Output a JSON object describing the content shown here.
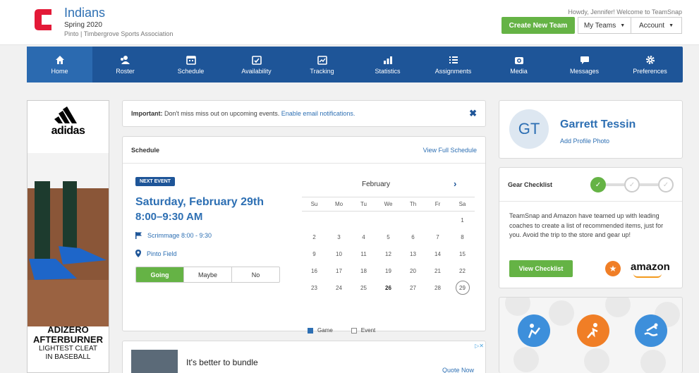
{
  "header": {
    "team_name": "Indians",
    "season": "Spring 2020",
    "division": "Pinto | Timbergrove Sports Association",
    "greeting": "Howdy, Jennifer! Welcome to TeamSnap",
    "create_team_label": "Create New Team",
    "my_teams_label": "My Teams",
    "account_label": "Account",
    "logo_color": "#e31937"
  },
  "nav": {
    "items": [
      {
        "label": "Home",
        "icon": "home-icon"
      },
      {
        "label": "Roster",
        "icon": "roster-icon"
      },
      {
        "label": "Schedule",
        "icon": "calendar-icon"
      },
      {
        "label": "Availability",
        "icon": "availability-icon"
      },
      {
        "label": "Tracking",
        "icon": "tracking-icon"
      },
      {
        "label": "Statistics",
        "icon": "statistics-icon"
      },
      {
        "label": "Assignments",
        "icon": "assignments-icon"
      },
      {
        "label": "Media",
        "icon": "camera-icon"
      },
      {
        "label": "Messages",
        "icon": "messages-icon"
      },
      {
        "label": "Preferences",
        "icon": "gear-icon"
      }
    ],
    "active": "Home",
    "color": "#1e5598"
  },
  "ad_left": {
    "brand": "adidas",
    "line1": "ADIZERO",
    "line2": "AFTERBURNER",
    "line3": "LIGHTEST CLEAT",
    "line4": "IN BASEBALL"
  },
  "alert": {
    "prefix": "Important:",
    "message": " Don't miss miss out on upcoming events. ",
    "link": "Enable email notifications."
  },
  "schedule": {
    "title": "Schedule",
    "view_full": "View Full Schedule",
    "badge": "NEXT EVENT",
    "event_date": "Saturday, February 29th",
    "event_time": "8:00–9:30 AM",
    "event_name": "Scrimmage 8:00 - 9:30",
    "location": "Pinto Field",
    "rsvp": [
      "Going",
      "Maybe",
      "No"
    ],
    "calendar": {
      "month": "February",
      "days_of_week": [
        "Su",
        "Mo",
        "Tu",
        "We",
        "Th",
        "Fr",
        "Sa"
      ],
      "weeks": [
        [
          "",
          "",
          "",
          "",
          "",
          "",
          "1"
        ],
        [
          "2",
          "3",
          "4",
          "5",
          "6",
          "7",
          "8"
        ],
        [
          "9",
          "10",
          "11",
          "12",
          "13",
          "14",
          "15"
        ],
        [
          "16",
          "17",
          "18",
          "19",
          "20",
          "21",
          "22"
        ],
        [
          "23",
          "24",
          "25",
          "26",
          "27",
          "28",
          "29"
        ]
      ],
      "bold_day": "26",
      "today": "29",
      "legend_game": "Game",
      "legend_event": "Event"
    }
  },
  "ad_bottom": {
    "headline": "It's better to bundle",
    "cta": "Quote Now",
    "adchoices": "▷✕"
  },
  "profile": {
    "initials": "GT",
    "name": "Garrett Tessin",
    "add_photo": "Add Profile Photo"
  },
  "gear": {
    "title": "Gear Checklist",
    "text": "TeamSnap and Amazon have teamed up with leading coaches to create a list of recommended items, just for you. Avoid the trip to the store and gear up!",
    "button": "View Checklist",
    "partner": "amazon"
  }
}
